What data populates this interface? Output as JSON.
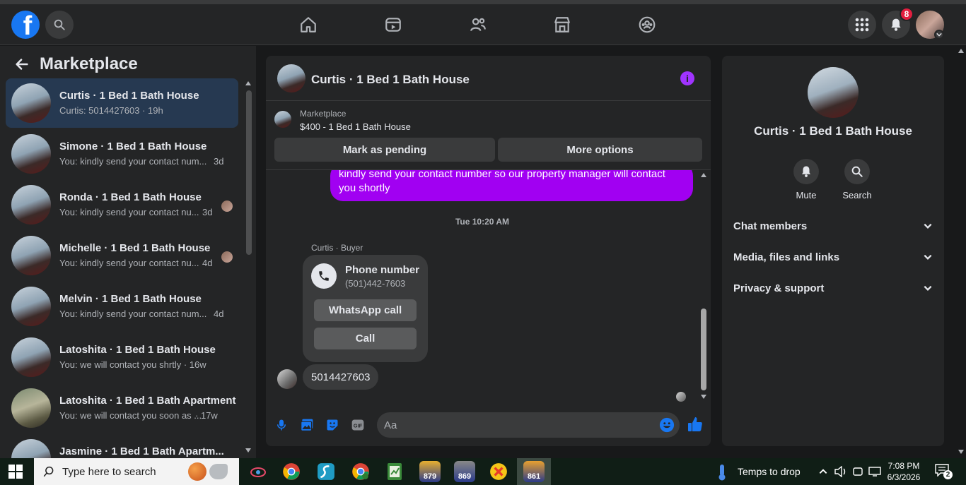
{
  "topbar": {
    "notifications_count": "8"
  },
  "sidebar": {
    "title": "Marketplace",
    "conversations": [
      {
        "title": "Curtis · 1 Bed 1 Bath House",
        "preview": "Curtis: 5014427603 · 19h",
        "time": ""
      },
      {
        "title": "Simone · 1 Bed 1 Bath House",
        "preview": "You: kindly send your contact num...",
        "time": "3d"
      },
      {
        "title": "Ronda · 1 Bed 1 Bath House",
        "preview": "You: kindly send your contact nu...",
        "time": "3d"
      },
      {
        "title": "Michelle · 1 Bed 1 Bath House",
        "preview": "You: kindly send your contact nu...",
        "time": "4d"
      },
      {
        "title": "Melvin · 1 Bed 1 Bath House",
        "preview": "You: kindly send your contact num...",
        "time": "4d"
      },
      {
        "title": "Latoshita · 1 Bed 1 Bath House",
        "preview": "You: we will contact you shrtly · 16w",
        "time": ""
      },
      {
        "title": "Latoshita · 1 Bed 1 Bath Apartment",
        "preview": "You: we will contact you soon as ...",
        "time": "· 17w"
      },
      {
        "title": "Jasmine · 1 Bed 1 Bath Apartm...",
        "preview": "",
        "time": ""
      }
    ]
  },
  "chat": {
    "title": "Curtis · 1 Bed 1 Bath House",
    "marketplace_label": "Marketplace",
    "listing": "$400 - 1 Bed 1 Bath House",
    "mark_pending": "Mark as pending",
    "more_options": "More options",
    "outgoing_message": "kindly send your contact number so our property manager will contact you shortly",
    "timestamp": "Tue 10:20 AM",
    "sender_label": "Curtis · Buyer",
    "card_title": "Phone number",
    "card_number": "(501)442-7603",
    "whatsapp_call": "WhatsApp call",
    "call": "Call",
    "incoming_message": "5014427603",
    "composer_placeholder": "Aa"
  },
  "details": {
    "title": "Curtis · 1 Bed 1 Bath House",
    "mute": "Mute",
    "search": "Search",
    "sections": [
      "Chat members",
      "Media, files and links",
      "Privacy & support"
    ]
  },
  "taskbar": {
    "search_placeholder": "Type here to search",
    "badge_1": "879",
    "badge_2": "869",
    "badge_3": "861",
    "weather": "Temps to drop",
    "time": "7:08 PM",
    "date": "6/3/2026",
    "notifications": "2"
  },
  "colors": {
    "accent_purple": "#a100f2",
    "facebook_blue": "#1877f2",
    "badge_red": "#e41e3f"
  }
}
